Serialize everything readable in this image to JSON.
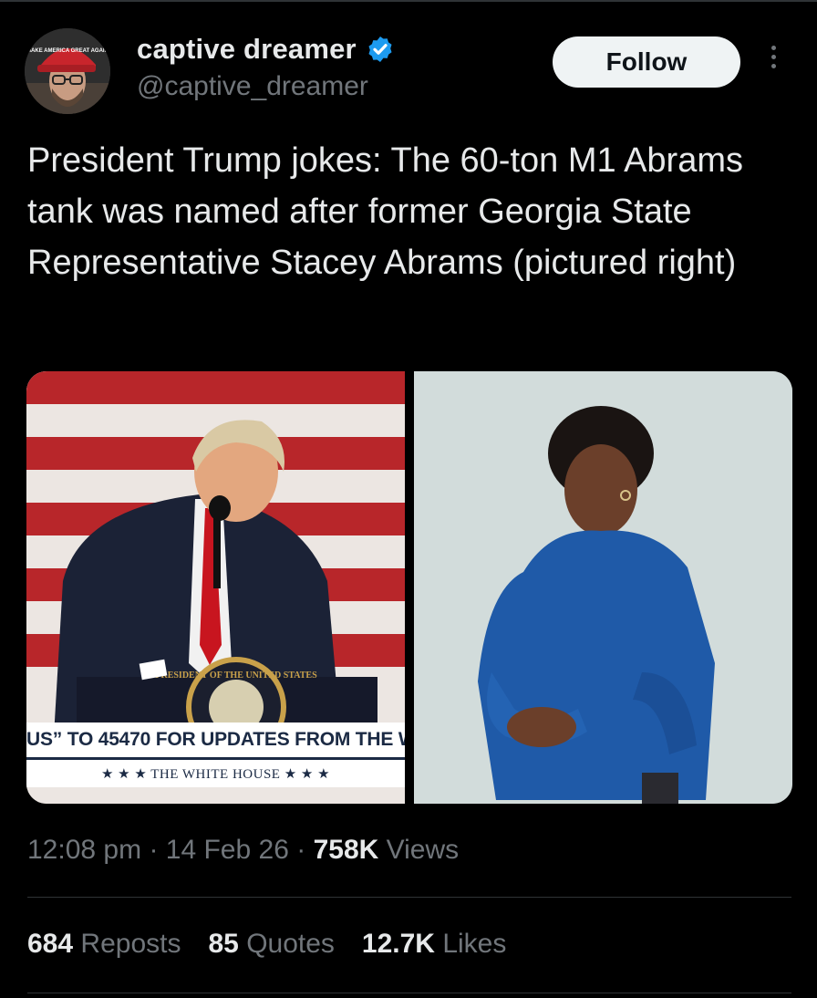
{
  "author": {
    "display_name": "captive dreamer",
    "handle": "@captive_dreamer",
    "verified": true,
    "avatar_hat_text": "MAKE AMERICA GREAT AGAIN"
  },
  "actions": {
    "follow_label": "Follow",
    "more_icon": "more-vertical-icon"
  },
  "tweet": {
    "text": "President Trump jokes: The 60-ton M1 Abrams tank was named after former Georgia State Representative Stacey Abrams (pictured right)"
  },
  "media": {
    "left": {
      "ticker_text": "US” TO 45470 FOR UPDATES FROM THE W",
      "ticker_sub": "★ ★ ★   THE WHITE HOUSE   ★ ★ ★",
      "seal_text": "PRESIDENT OF THE UNITED STATES"
    }
  },
  "meta": {
    "time": "12:08 pm",
    "dot1": "·",
    "date": "14 Feb 26",
    "dot2": "·",
    "views_count": "758K",
    "views_label": "Views"
  },
  "stats": {
    "reposts_count": "684",
    "reposts_label": "Reposts",
    "quotes_count": "85",
    "quotes_label": "Quotes",
    "likes_count": "12.7K",
    "likes_label": "Likes"
  },
  "colors": {
    "background": "#000000",
    "text_primary": "#e7e9ea",
    "text_secondary": "#71767b",
    "verified_blue": "#1d9bf0",
    "follow_bg": "#eff3f4"
  }
}
